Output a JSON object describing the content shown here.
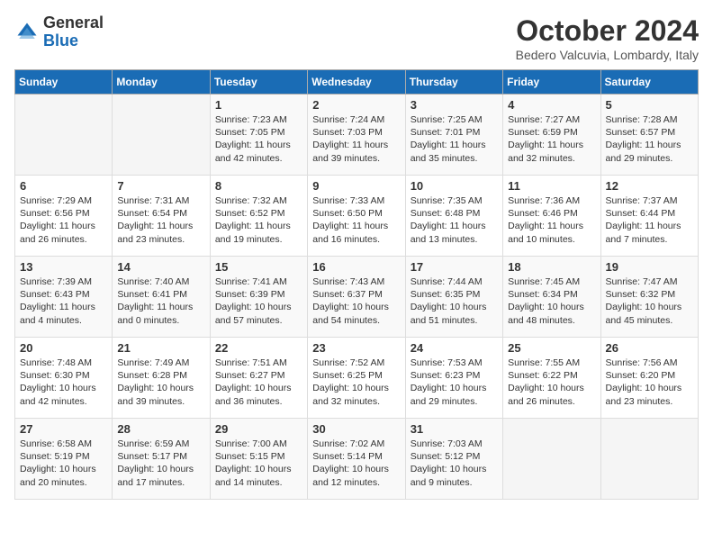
{
  "logo": {
    "general": "General",
    "blue": "Blue"
  },
  "header": {
    "month": "October 2024",
    "location": "Bedero Valcuvia, Lombardy, Italy"
  },
  "weekdays": [
    "Sunday",
    "Monday",
    "Tuesday",
    "Wednesday",
    "Thursday",
    "Friday",
    "Saturday"
  ],
  "weeks": [
    [
      {
        "day": "",
        "sunrise": "",
        "sunset": "",
        "daylight": ""
      },
      {
        "day": "",
        "sunrise": "",
        "sunset": "",
        "daylight": ""
      },
      {
        "day": "1",
        "sunrise": "Sunrise: 7:23 AM",
        "sunset": "Sunset: 7:05 PM",
        "daylight": "Daylight: 11 hours and 42 minutes."
      },
      {
        "day": "2",
        "sunrise": "Sunrise: 7:24 AM",
        "sunset": "Sunset: 7:03 PM",
        "daylight": "Daylight: 11 hours and 39 minutes."
      },
      {
        "day": "3",
        "sunrise": "Sunrise: 7:25 AM",
        "sunset": "Sunset: 7:01 PM",
        "daylight": "Daylight: 11 hours and 35 minutes."
      },
      {
        "day": "4",
        "sunrise": "Sunrise: 7:27 AM",
        "sunset": "Sunset: 6:59 PM",
        "daylight": "Daylight: 11 hours and 32 minutes."
      },
      {
        "day": "5",
        "sunrise": "Sunrise: 7:28 AM",
        "sunset": "Sunset: 6:57 PM",
        "daylight": "Daylight: 11 hours and 29 minutes."
      }
    ],
    [
      {
        "day": "6",
        "sunrise": "Sunrise: 7:29 AM",
        "sunset": "Sunset: 6:56 PM",
        "daylight": "Daylight: 11 hours and 26 minutes."
      },
      {
        "day": "7",
        "sunrise": "Sunrise: 7:31 AM",
        "sunset": "Sunset: 6:54 PM",
        "daylight": "Daylight: 11 hours and 23 minutes."
      },
      {
        "day": "8",
        "sunrise": "Sunrise: 7:32 AM",
        "sunset": "Sunset: 6:52 PM",
        "daylight": "Daylight: 11 hours and 19 minutes."
      },
      {
        "day": "9",
        "sunrise": "Sunrise: 7:33 AM",
        "sunset": "Sunset: 6:50 PM",
        "daylight": "Daylight: 11 hours and 16 minutes."
      },
      {
        "day": "10",
        "sunrise": "Sunrise: 7:35 AM",
        "sunset": "Sunset: 6:48 PM",
        "daylight": "Daylight: 11 hours and 13 minutes."
      },
      {
        "day": "11",
        "sunrise": "Sunrise: 7:36 AM",
        "sunset": "Sunset: 6:46 PM",
        "daylight": "Daylight: 11 hours and 10 minutes."
      },
      {
        "day": "12",
        "sunrise": "Sunrise: 7:37 AM",
        "sunset": "Sunset: 6:44 PM",
        "daylight": "Daylight: 11 hours and 7 minutes."
      }
    ],
    [
      {
        "day": "13",
        "sunrise": "Sunrise: 7:39 AM",
        "sunset": "Sunset: 6:43 PM",
        "daylight": "Daylight: 11 hours and 4 minutes."
      },
      {
        "day": "14",
        "sunrise": "Sunrise: 7:40 AM",
        "sunset": "Sunset: 6:41 PM",
        "daylight": "Daylight: 11 hours and 0 minutes."
      },
      {
        "day": "15",
        "sunrise": "Sunrise: 7:41 AM",
        "sunset": "Sunset: 6:39 PM",
        "daylight": "Daylight: 10 hours and 57 minutes."
      },
      {
        "day": "16",
        "sunrise": "Sunrise: 7:43 AM",
        "sunset": "Sunset: 6:37 PM",
        "daylight": "Daylight: 10 hours and 54 minutes."
      },
      {
        "day": "17",
        "sunrise": "Sunrise: 7:44 AM",
        "sunset": "Sunset: 6:35 PM",
        "daylight": "Daylight: 10 hours and 51 minutes."
      },
      {
        "day": "18",
        "sunrise": "Sunrise: 7:45 AM",
        "sunset": "Sunset: 6:34 PM",
        "daylight": "Daylight: 10 hours and 48 minutes."
      },
      {
        "day": "19",
        "sunrise": "Sunrise: 7:47 AM",
        "sunset": "Sunset: 6:32 PM",
        "daylight": "Daylight: 10 hours and 45 minutes."
      }
    ],
    [
      {
        "day": "20",
        "sunrise": "Sunrise: 7:48 AM",
        "sunset": "Sunset: 6:30 PM",
        "daylight": "Daylight: 10 hours and 42 minutes."
      },
      {
        "day": "21",
        "sunrise": "Sunrise: 7:49 AM",
        "sunset": "Sunset: 6:28 PM",
        "daylight": "Daylight: 10 hours and 39 minutes."
      },
      {
        "day": "22",
        "sunrise": "Sunrise: 7:51 AM",
        "sunset": "Sunset: 6:27 PM",
        "daylight": "Daylight: 10 hours and 36 minutes."
      },
      {
        "day": "23",
        "sunrise": "Sunrise: 7:52 AM",
        "sunset": "Sunset: 6:25 PM",
        "daylight": "Daylight: 10 hours and 32 minutes."
      },
      {
        "day": "24",
        "sunrise": "Sunrise: 7:53 AM",
        "sunset": "Sunset: 6:23 PM",
        "daylight": "Daylight: 10 hours and 29 minutes."
      },
      {
        "day": "25",
        "sunrise": "Sunrise: 7:55 AM",
        "sunset": "Sunset: 6:22 PM",
        "daylight": "Daylight: 10 hours and 26 minutes."
      },
      {
        "day": "26",
        "sunrise": "Sunrise: 7:56 AM",
        "sunset": "Sunset: 6:20 PM",
        "daylight": "Daylight: 10 hours and 23 minutes."
      }
    ],
    [
      {
        "day": "27",
        "sunrise": "Sunrise: 6:58 AM",
        "sunset": "Sunset: 5:19 PM",
        "daylight": "Daylight: 10 hours and 20 minutes."
      },
      {
        "day": "28",
        "sunrise": "Sunrise: 6:59 AM",
        "sunset": "Sunset: 5:17 PM",
        "daylight": "Daylight: 10 hours and 17 minutes."
      },
      {
        "day": "29",
        "sunrise": "Sunrise: 7:00 AM",
        "sunset": "Sunset: 5:15 PM",
        "daylight": "Daylight: 10 hours and 14 minutes."
      },
      {
        "day": "30",
        "sunrise": "Sunrise: 7:02 AM",
        "sunset": "Sunset: 5:14 PM",
        "daylight": "Daylight: 10 hours and 12 minutes."
      },
      {
        "day": "31",
        "sunrise": "Sunrise: 7:03 AM",
        "sunset": "Sunset: 5:12 PM",
        "daylight": "Daylight: 10 hours and 9 minutes."
      },
      {
        "day": "",
        "sunrise": "",
        "sunset": "",
        "daylight": ""
      },
      {
        "day": "",
        "sunrise": "",
        "sunset": "",
        "daylight": ""
      }
    ]
  ]
}
